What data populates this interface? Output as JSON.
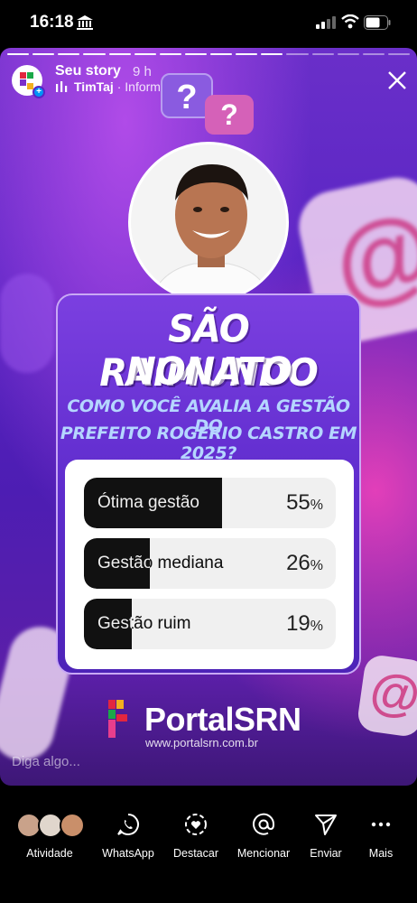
{
  "status_bar": {
    "time": "16:18"
  },
  "story": {
    "user": "Seu story",
    "age": "9 h",
    "music": "TimTaj",
    "info": "· Information",
    "reply_placeholder": "Diga algo..."
  },
  "post": {
    "headline_line1": "SÃO RAIMUNDO",
    "headline_line2": "NONATO",
    "question_line1": "COMO VOCÊ AVALIA A GESTÃO DO",
    "question_line2": "PREFEITO ROGÉRIO CASTRO EM 2025?",
    "poll": [
      {
        "label": "Ótima gestão",
        "percent": 55
      },
      {
        "label": "Gestão mediana",
        "percent": 26
      },
      {
        "label": "Gestão ruim",
        "percent": 19
      }
    ],
    "brand": "PortalSRN",
    "brand_url": "www.portalsrn.com.br"
  },
  "actions": [
    {
      "label": "Atividade",
      "icon": "activity-faces"
    },
    {
      "label": "WhatsApp",
      "icon": "whatsapp-icon"
    },
    {
      "label": "Destacar",
      "icon": "highlight-icon"
    },
    {
      "label": "Mencionar",
      "icon": "mention-icon"
    },
    {
      "label": "Enviar",
      "icon": "send-icon"
    },
    {
      "label": "Mais",
      "icon": "more-icon"
    }
  ]
}
